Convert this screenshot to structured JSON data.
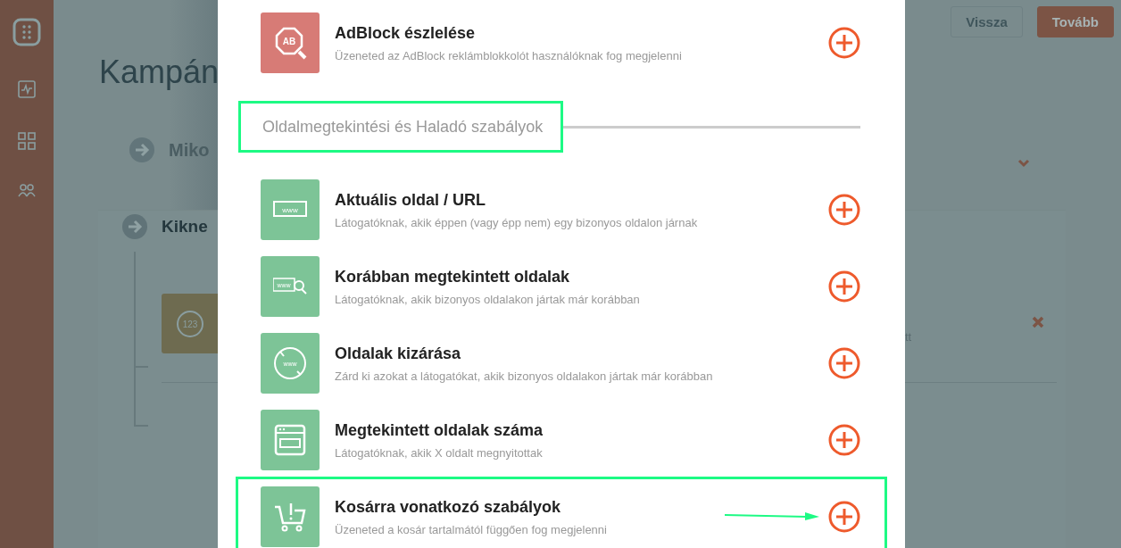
{
  "background": {
    "page_title": "Kampán",
    "steps": [
      {
        "label": "Miko",
        "kind": "collapsed"
      },
      {
        "label": "Kikne",
        "kind": "open"
      }
    ],
    "tile_icon_text": "123",
    "rule_fragment": "tt",
    "buttons": [
      {
        "label": "Vissza",
        "kind": "secondary"
      },
      {
        "label": "Tovább",
        "kind": "primary"
      }
    ]
  },
  "modal": {
    "items": [
      {
        "kind": "rule",
        "icon_text": "AB",
        "color": "#d77b76",
        "title": "AdBlock észlelése",
        "description": "Üzeneted az AdBlock reklámblokkolót használóknak fog megjelenni",
        "highlighted": false
      },
      {
        "kind": "heading",
        "title": "Oldalmegtekintési és Haladó szabályok",
        "highlighted": true
      },
      {
        "kind": "rule",
        "icon_text": "www",
        "color": "#7dc497",
        "title": "Aktuális oldal / URL",
        "description": "Látogatóknak, akik éppen (vagy épp nem) egy bizonyos oldalon járnak",
        "highlighted": false
      },
      {
        "kind": "rule",
        "icon_text": "www",
        "color": "#7dc497",
        "title": "Korábban megtekintett oldalak",
        "description": "Látogatóknak, akik bizonyos oldalakon jártak már korábban",
        "highlighted": false
      },
      {
        "kind": "rule",
        "icon_text": "www",
        "color": "#7dc497",
        "title": "Oldalak kizárása",
        "description": "Zárd ki azokat a látogatókat, akik bizonyos oldalakon jártak már korábban",
        "highlighted": false
      },
      {
        "kind": "rule",
        "color": "#7dc497",
        "title": "Megtekintett oldalak száma",
        "description": "Látogatóknak, akik X oldalt megnyitottak",
        "highlighted": false
      },
      {
        "kind": "rule",
        "color": "#7dc497",
        "title": "Kosárra vonatkozó szabályok",
        "description": "Üzeneted a kosár tartalmától függően fog megjelenni",
        "highlighted": true
      }
    ]
  }
}
